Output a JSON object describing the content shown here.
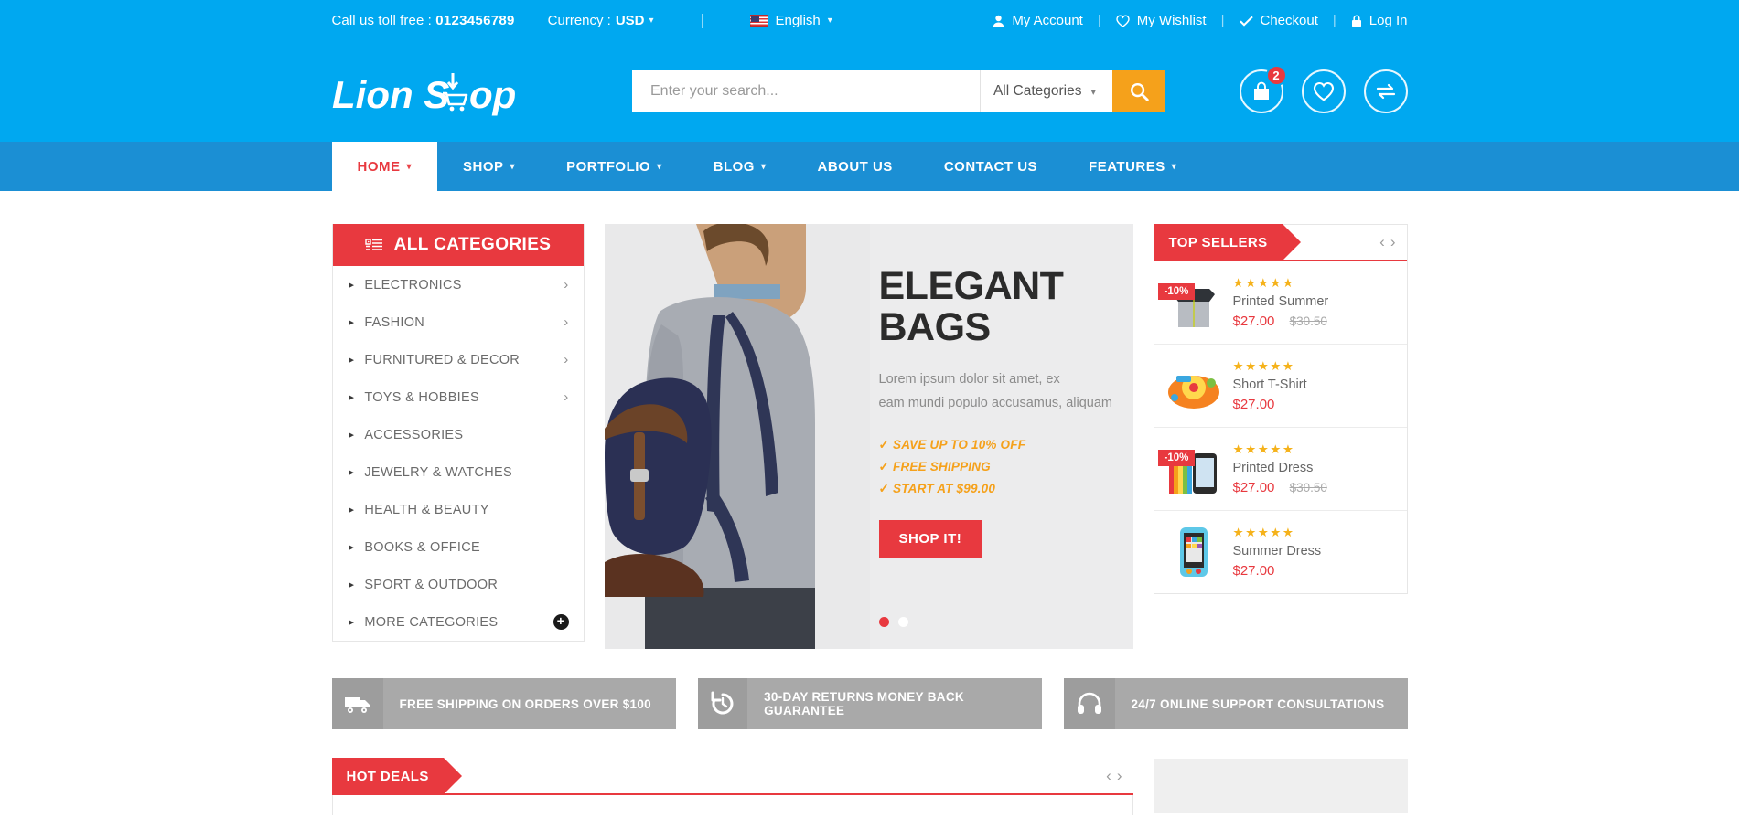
{
  "topbar": {
    "tollfree_label": "Call us toll free : ",
    "tollfree_number": "0123456789",
    "currency_label": "Currency : ",
    "currency_value": "USD",
    "language": "English",
    "links": [
      {
        "label": "My Account",
        "icon": "user-icon"
      },
      {
        "label": "My Wishlist",
        "icon": "heart-icon"
      },
      {
        "label": "Checkout",
        "icon": "check-icon"
      },
      {
        "label": "Log In",
        "icon": "lock-icon"
      }
    ]
  },
  "header": {
    "logo_text": "LionShop",
    "search_placeholder": "Enter your search...",
    "search_value": "",
    "category_selected": "All Categories",
    "search_icon": "search-icon",
    "cart_count": "2",
    "icons": [
      "cart-icon",
      "wishlist-heart-icon",
      "compare-icon"
    ]
  },
  "nav": {
    "items": [
      {
        "label": "HOME",
        "has_caret": true,
        "active": true
      },
      {
        "label": "SHOP",
        "has_caret": true,
        "active": false
      },
      {
        "label": "PORTFOLIO",
        "has_caret": true,
        "active": false
      },
      {
        "label": "BLOG",
        "has_caret": true,
        "active": false
      },
      {
        "label": "ABOUT US",
        "has_caret": false,
        "active": false
      },
      {
        "label": "CONTACT US",
        "has_caret": false,
        "active": false
      },
      {
        "label": "FEATURES",
        "has_caret": true,
        "active": false
      }
    ]
  },
  "categories": {
    "title": "ALL CATEGORIES",
    "icon": "list-icon",
    "items": [
      {
        "label": "ELECTRONICS",
        "chevron": true,
        "plus": false
      },
      {
        "label": "FASHION",
        "chevron": true,
        "plus": false
      },
      {
        "label": "FURNITURED & DECOR",
        "chevron": true,
        "plus": false
      },
      {
        "label": "TOYS & HOBBIES",
        "chevron": true,
        "plus": false
      },
      {
        "label": "ACCESSORIES",
        "chevron": false,
        "plus": false
      },
      {
        "label": "JEWELRY & WATCHES",
        "chevron": false,
        "plus": false
      },
      {
        "label": "HEALTH & BEAUTY",
        "chevron": false,
        "plus": false
      },
      {
        "label": "BOOKS & OFFICE",
        "chevron": false,
        "plus": false
      },
      {
        "label": "SPORT & OUTDOOR",
        "chevron": false,
        "plus": false
      },
      {
        "label": "MORE CATEGORIES",
        "chevron": false,
        "plus": true
      }
    ]
  },
  "hero": {
    "title_line1": "ELEGANT",
    "title_line2": "BAGS",
    "desc_line1": "Lorem ipsum dolor sit amet, ex",
    "desc_line2": "eam mundi populo accusamus, aliquam",
    "bullets": [
      "SAVE UP TO 10% OFF",
      "FREE SHIPPING",
      "START AT $99.00"
    ],
    "cta": "SHOP IT!",
    "slide_count": 2,
    "active_slide": 1
  },
  "sellers": {
    "title": "TOP SELLERS",
    "prev": "‹",
    "next": "›",
    "products": [
      {
        "name": "Printed Summer",
        "price": "$27.00",
        "old_price": "$30.50",
        "discount": "-10%",
        "rating": "★★★★★",
        "image": "grey-black-jacket"
      },
      {
        "name": "Short T-Shirt",
        "price": "$27.00",
        "old_price": "",
        "discount": "",
        "rating": "★★★★★",
        "image": "orange-toy-steering-wheel"
      },
      {
        "name": "Printed Dress",
        "price": "$27.00",
        "old_price": "$30.50",
        "discount": "-10%",
        "rating": "★★★★★",
        "image": "smartphone-colorful"
      },
      {
        "name": "Summer Dress",
        "price": "$27.00",
        "old_price": "",
        "discount": "",
        "rating": "★★★★★",
        "image": "blue-kids-phone"
      }
    ]
  },
  "services": [
    {
      "label": "FREE SHIPPING ON ORDERS OVER $100",
      "icon": "truck-icon"
    },
    {
      "label": "30-DAY RETURNS MONEY BACK GUARANTEE",
      "icon": "return-arrow-icon"
    },
    {
      "label": "24/7 ONLINE SUPPORT CONSULTATIONS",
      "icon": "headphones-icon"
    }
  ],
  "deals": {
    "title": "HOT DEALS",
    "prev": "‹",
    "next": "›"
  },
  "colors": {
    "sky": "#00a8f0",
    "nav_blue": "#1b8fd4",
    "red": "#e8393f",
    "orange": "#f5a11b",
    "star": "#f5b21b",
    "grey": "#a9a9a9"
  }
}
